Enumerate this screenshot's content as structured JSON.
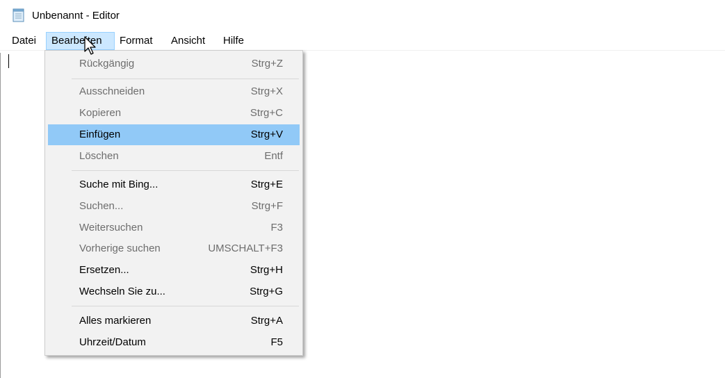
{
  "window": {
    "title": "Unbenannt - Editor",
    "icon": "notepad-icon"
  },
  "menubar": {
    "items": [
      {
        "label": "Datei"
      },
      {
        "label": "Bearbeiten",
        "open": true
      },
      {
        "label": "Format"
      },
      {
        "label": "Ansicht"
      },
      {
        "label": "Hilfe"
      }
    ]
  },
  "edit_menu": {
    "items": [
      {
        "label": "Rückgängig",
        "shortcut": "Strg+Z",
        "enabled": false
      },
      {
        "label": "Ausschneiden",
        "shortcut": "Strg+X",
        "enabled": false
      },
      {
        "label": "Kopieren",
        "shortcut": "Strg+C",
        "enabled": false
      },
      {
        "label": "Einfügen",
        "shortcut": "Strg+V",
        "enabled": true,
        "highlighted": true
      },
      {
        "label": "Löschen",
        "shortcut": "Entf",
        "enabled": false
      },
      {
        "label": "Suche mit Bing...",
        "shortcut": "Strg+E",
        "enabled": true
      },
      {
        "label": "Suchen...",
        "shortcut": "Strg+F",
        "enabled": false
      },
      {
        "label": "Weitersuchen",
        "shortcut": "F3",
        "enabled": false
      },
      {
        "label": "Vorherige suchen",
        "shortcut": "UMSCHALT+F3",
        "enabled": false
      },
      {
        "label": "Ersetzen...",
        "shortcut": "Strg+H",
        "enabled": true
      },
      {
        "label": "Wechseln Sie zu...",
        "shortcut": "Strg+G",
        "enabled": true
      },
      {
        "label": "Alles markieren",
        "shortcut": "Strg+A",
        "enabled": true
      },
      {
        "label": "Uhrzeit/Datum",
        "shortcut": "F5",
        "enabled": true
      }
    ]
  },
  "colors": {
    "menu_bg": "#f2f2f2",
    "highlight": "#91c9f7",
    "disabled_text": "#6d6d6d",
    "open_menu_bg": "#cce8ff"
  }
}
